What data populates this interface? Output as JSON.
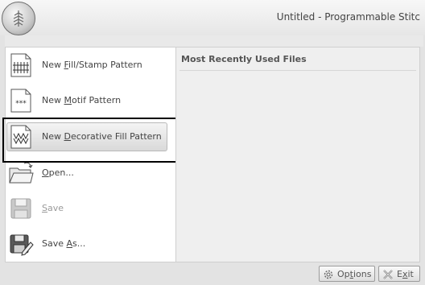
{
  "window": {
    "title": "Untitled - Programmable Stitc",
    "app_button_icon": "feather-app-icon"
  },
  "menu_items": [
    {
      "label": "New Fill/Stamp Pattern",
      "icon": "fill-stamp-pattern-icon",
      "enabled": true,
      "selected": false
    },
    {
      "label": "New Motif Pattern",
      "icon": "motif-pattern-icon",
      "enabled": true,
      "selected": false
    },
    {
      "label": "New Decorative Fill Pattern",
      "icon": "decorative-fill-pattern-icon",
      "enabled": true,
      "selected": true
    },
    {
      "label": "Open...",
      "icon": "open-folder-icon",
      "enabled": true,
      "selected": false
    },
    {
      "label": "Save",
      "icon": "save-disk-icon",
      "enabled": false,
      "selected": false
    },
    {
      "label": "Save As...",
      "icon": "save-as-icon",
      "enabled": true,
      "selected": false
    }
  ],
  "mru": {
    "title": "Most Recently Used Files"
  },
  "footer": {
    "options_label": "Options",
    "exit_label": "Exit"
  }
}
